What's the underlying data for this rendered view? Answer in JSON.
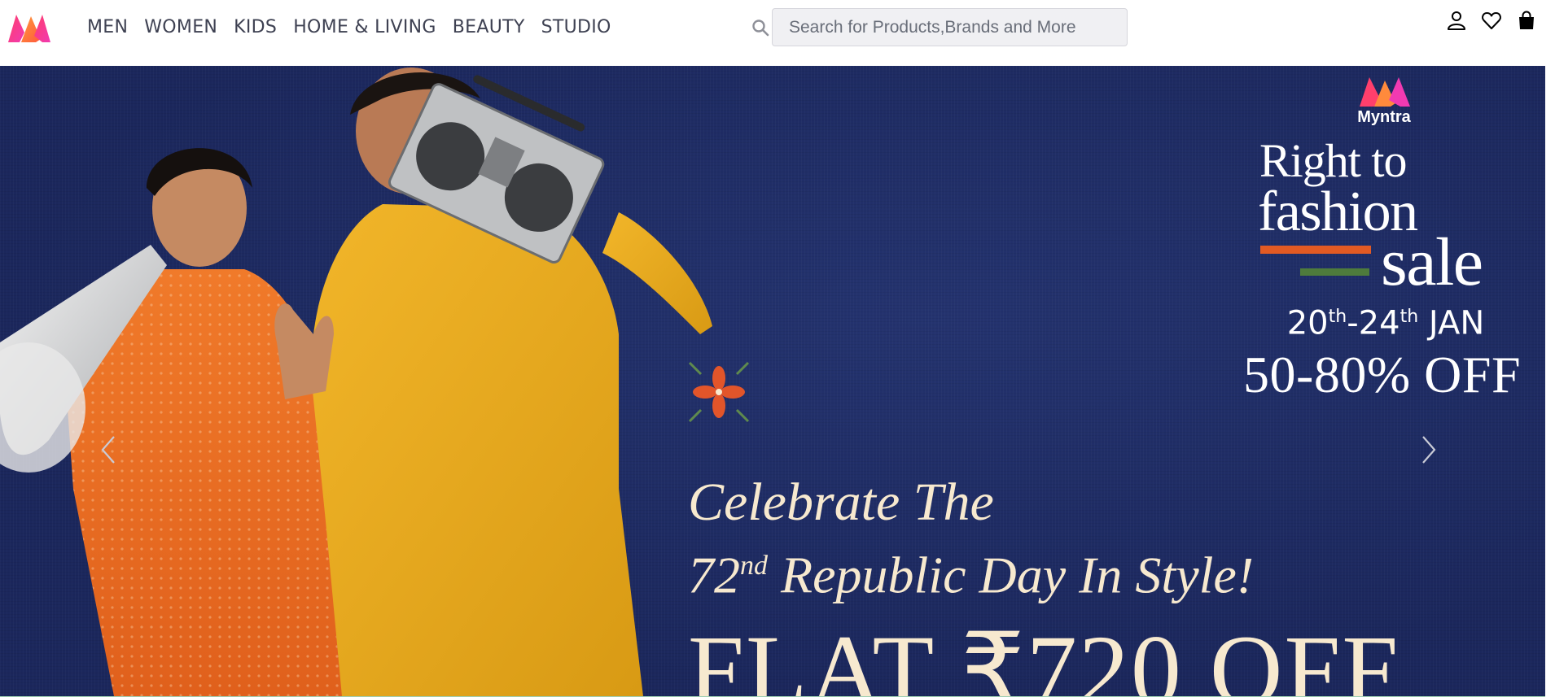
{
  "header": {
    "logo_icon": "myntra-logo-icon",
    "nav_items": [
      "MEN",
      "WOMEN",
      "KIDS",
      "HOME & LIVING",
      "BEAUTY",
      "STUDIO"
    ],
    "search": {
      "icon": "search-icon",
      "placeholder": "Search for Products,Brands and More",
      "value": ""
    },
    "icons": [
      "profile-icon",
      "wishlist-heart-icon",
      "bag-icon"
    ]
  },
  "hero": {
    "background_color": "#1d2a63",
    "brand_name": "Myntra",
    "sale_title": {
      "line1": "Right to",
      "line2": "fashion",
      "line3": "sale"
    },
    "sale_dates": {
      "start_day": "20",
      "start_suffix": "th",
      "separator": "-",
      "end_day": "24",
      "end_suffix": "th",
      "month": "JAN"
    },
    "discount": "50-80% OFF",
    "celebrate_line1": "Celebrate The",
    "celebrate_line2": {
      "number": "72",
      "suffix": "nd",
      "rest": "Republic Day In Style!"
    },
    "flat_offer": "FLAT ₹720 OFF",
    "carousel": {
      "prev_icon": "chevron-left-icon",
      "next_icon": "chevron-right-icon"
    },
    "colors": {
      "accent_text": "#f7e9cf",
      "saffron": "#e25a23",
      "green": "#4e7b3c"
    }
  }
}
